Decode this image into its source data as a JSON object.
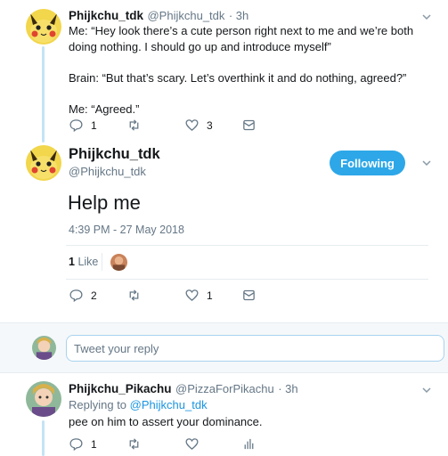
{
  "parent_tweet": {
    "name": "Phijkchu_tdk",
    "handle": "@Phijkchu_tdk",
    "time": "· 3h",
    "text": "Me: “Hey look there’s a cute person right next to me and we’re both doing nothing. I should go up and introduce myself”\n\nBrain: “But that’s scary. Let’s overthink it and do nothing, agreed?”\n\nMe: “Agreed.”",
    "replies": "1",
    "retweets": "",
    "likes": "3"
  },
  "main_tweet": {
    "name": "Phijkchu_tdk",
    "handle": "@Phijkchu_tdk",
    "follow_label": "Following",
    "text": "Help me",
    "timestamp": "4:39 PM - 27 May 2018",
    "like_count": "1",
    "like_label": "Like",
    "replies": "2",
    "retweets": "",
    "likes": "1"
  },
  "reply_box": {
    "placeholder": "Tweet your reply"
  },
  "reply_tweet": {
    "name": "Phijkchu_Pikachu",
    "handle": "@PizzaForPikachu",
    "time": "· 3h",
    "replying_prefix": "Replying to",
    "replying_to": "@Phijkchu_tdk",
    "text": "pee on him to assert your dominance.",
    "replies": "1",
    "retweets": "",
    "likes": ""
  },
  "colors": {
    "accent": "#2da7e8",
    "link": "#1b95e0",
    "muted": "#657786",
    "thread_line": "#c4e3f5"
  }
}
